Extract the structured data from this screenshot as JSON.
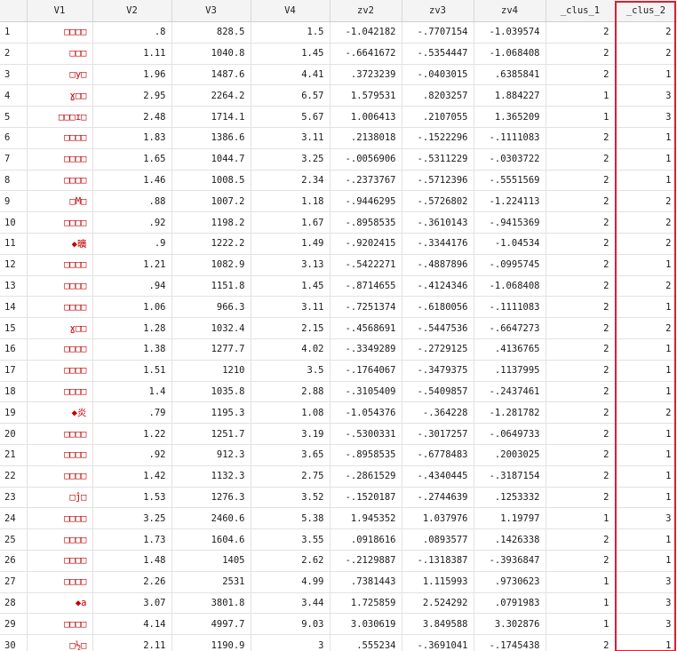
{
  "columns": [
    "V1",
    "V2",
    "V3",
    "V4",
    "zv2",
    "zv3",
    "zv4",
    "_clus_1",
    "_clus_2"
  ],
  "rows": [
    [
      "1",
      "□□□□",
      ".8",
      "828.5",
      "1.5",
      "-1.042182",
      "-.7707154",
      "-1.039574",
      "2",
      "2"
    ],
    [
      "2",
      "□□□",
      "1.11",
      "1040.8",
      "1.45",
      "-.6641672",
      "-.5354447",
      "-1.068408",
      "2",
      "2"
    ],
    [
      "3",
      "□y□",
      "1.96",
      "1487.6",
      "4.41",
      ".3723239",
      "-.0403015",
      ".6385841",
      "2",
      "1"
    ],
    [
      "4",
      "ɣ□□",
      "2.95",
      "2264.2",
      "6.57",
      "1.579531",
      ".8203257",
      "1.884227",
      "1",
      "3"
    ],
    [
      "5",
      "□□□ɪ□",
      "2.48",
      "1714.1",
      "5.67",
      "1.006413",
      ".2107055",
      "1.365209",
      "1",
      "3"
    ],
    [
      "6",
      "□□□□",
      "1.83",
      "1386.6",
      "3.11",
      ".2138018",
      "-.1522296",
      "-.1111083",
      "2",
      "1"
    ],
    [
      "7",
      "□□□□",
      "1.65",
      "1044.7",
      "3.25",
      "-.0056906",
      "-.5311229",
      "-.0303722",
      "2",
      "1"
    ],
    [
      "8",
      "□□□□",
      "1.46",
      "1008.5",
      "2.34",
      "-.2373767",
      "-.5712396",
      "-.5551569",
      "2",
      "1"
    ],
    [
      "9",
      "□M□",
      ".88",
      "1007.2",
      "1.18",
      "-.9446295",
      "-.5726802",
      "-1.224113",
      "2",
      "2"
    ],
    [
      "10",
      "□□□□",
      ".92",
      "1198.2",
      "1.67",
      "-.8958535",
      "-.3610143",
      "-.9415369",
      "2",
      "2"
    ],
    [
      "11",
      "◆曠",
      ".9",
      "1222.2",
      "1.49",
      "-.9202415",
      "-.3344176",
      "-1.04534",
      "2",
      "2"
    ],
    [
      "12",
      "□□□□",
      "1.21",
      "1082.9",
      "3.13",
      "-.5422271",
      "-.4887896",
      "-.0995745",
      "2",
      "1"
    ],
    [
      "13",
      "□□□□",
      ".94",
      "1151.8",
      "1.45",
      "-.8714655",
      "-.4124346",
      "-1.068408",
      "2",
      "2"
    ],
    [
      "14",
      "□□□□",
      "1.06",
      "966.3",
      "3.11",
      "-.7251374",
      "-.6180056",
      "-.1111083",
      "2",
      "1"
    ],
    [
      "15",
      "ɣ□□",
      "1.28",
      "1032.4",
      "2.15",
      "-.4568691",
      "-.5447536",
      "-.6647273",
      "2",
      "2"
    ],
    [
      "16",
      "□□□□",
      "1.38",
      "1277.7",
      "4.02",
      "-.3349289",
      "-.2729125",
      ".4136765",
      "2",
      "1"
    ],
    [
      "17",
      "□□□□",
      "1.51",
      "1210",
      "3.5",
      "-.1764067",
      "-.3479375",
      ".1137995",
      "2",
      "1"
    ],
    [
      "18",
      "□□□□",
      "1.4",
      "1035.8",
      "2.88",
      "-.3105409",
      "-.5409857",
      "-.2437461",
      "2",
      "1"
    ],
    [
      "19",
      "◆炎",
      ".79",
      "1195.3",
      "1.08",
      "-1.054376",
      "-.364228",
      "-1.281782",
      "2",
      "2"
    ],
    [
      "20",
      "□□□□",
      "1.22",
      "1251.7",
      "3.19",
      "-.5300331",
      "-.3017257",
      "-.0649733",
      "2",
      "1"
    ],
    [
      "21",
      "□□□□",
      ".92",
      "912.3",
      "3.65",
      "-.8958535",
      "-.6778483",
      ".2003025",
      "2",
      "1"
    ],
    [
      "22",
      "□□□□",
      "1.42",
      "1132.3",
      "2.75",
      "-.2861529",
      "-.4340445",
      "-.3187154",
      "2",
      "1"
    ],
    [
      "23",
      "□ĵ□",
      "1.53",
      "1276.3",
      "3.52",
      "-.1520187",
      "-.2744639",
      ".1253332",
      "2",
      "1"
    ],
    [
      "24",
      "□□□□",
      "3.25",
      "2460.6",
      "5.38",
      "1.945352",
      "1.037976",
      "1.19797",
      "1",
      "3"
    ],
    [
      "25",
      "□□□□",
      "1.73",
      "1604.6",
      "3.55",
      ".0918616",
      ".0893577",
      ".1426338",
      "2",
      "1"
    ],
    [
      "26",
      "□□□□",
      "1.48",
      "1405",
      "2.62",
      "-.2129887",
      "-.1318387",
      "-.3936847",
      "2",
      "1"
    ],
    [
      "27",
      "□□□□",
      "2.26",
      "2531",
      "4.99",
      ".7381443",
      "1.115993",
      ".9730623",
      "1",
      "3"
    ],
    [
      "28",
      "◆a",
      "3.07",
      "3801.8",
      "3.44",
      "1.725859",
      "2.524292",
      ".0791983",
      "1",
      "3"
    ],
    [
      "29",
      "□□□□",
      "4.14",
      "4997.7",
      "9.03",
      "3.030619",
      "3.849588",
      "3.302876",
      "1",
      "3"
    ],
    [
      "30",
      "□½□",
      "2.11",
      "1190.9",
      "3",
      ".555234",
      "-.3691041",
      "-.1745438",
      "2",
      "1"
    ]
  ],
  "colors": {
    "header_bg": "#f4f4f4",
    "grid_line": "#e2e2e2",
    "v1_text": "#c00000",
    "selection_border": "#d6202f"
  },
  "selected_column": "_clus_2"
}
